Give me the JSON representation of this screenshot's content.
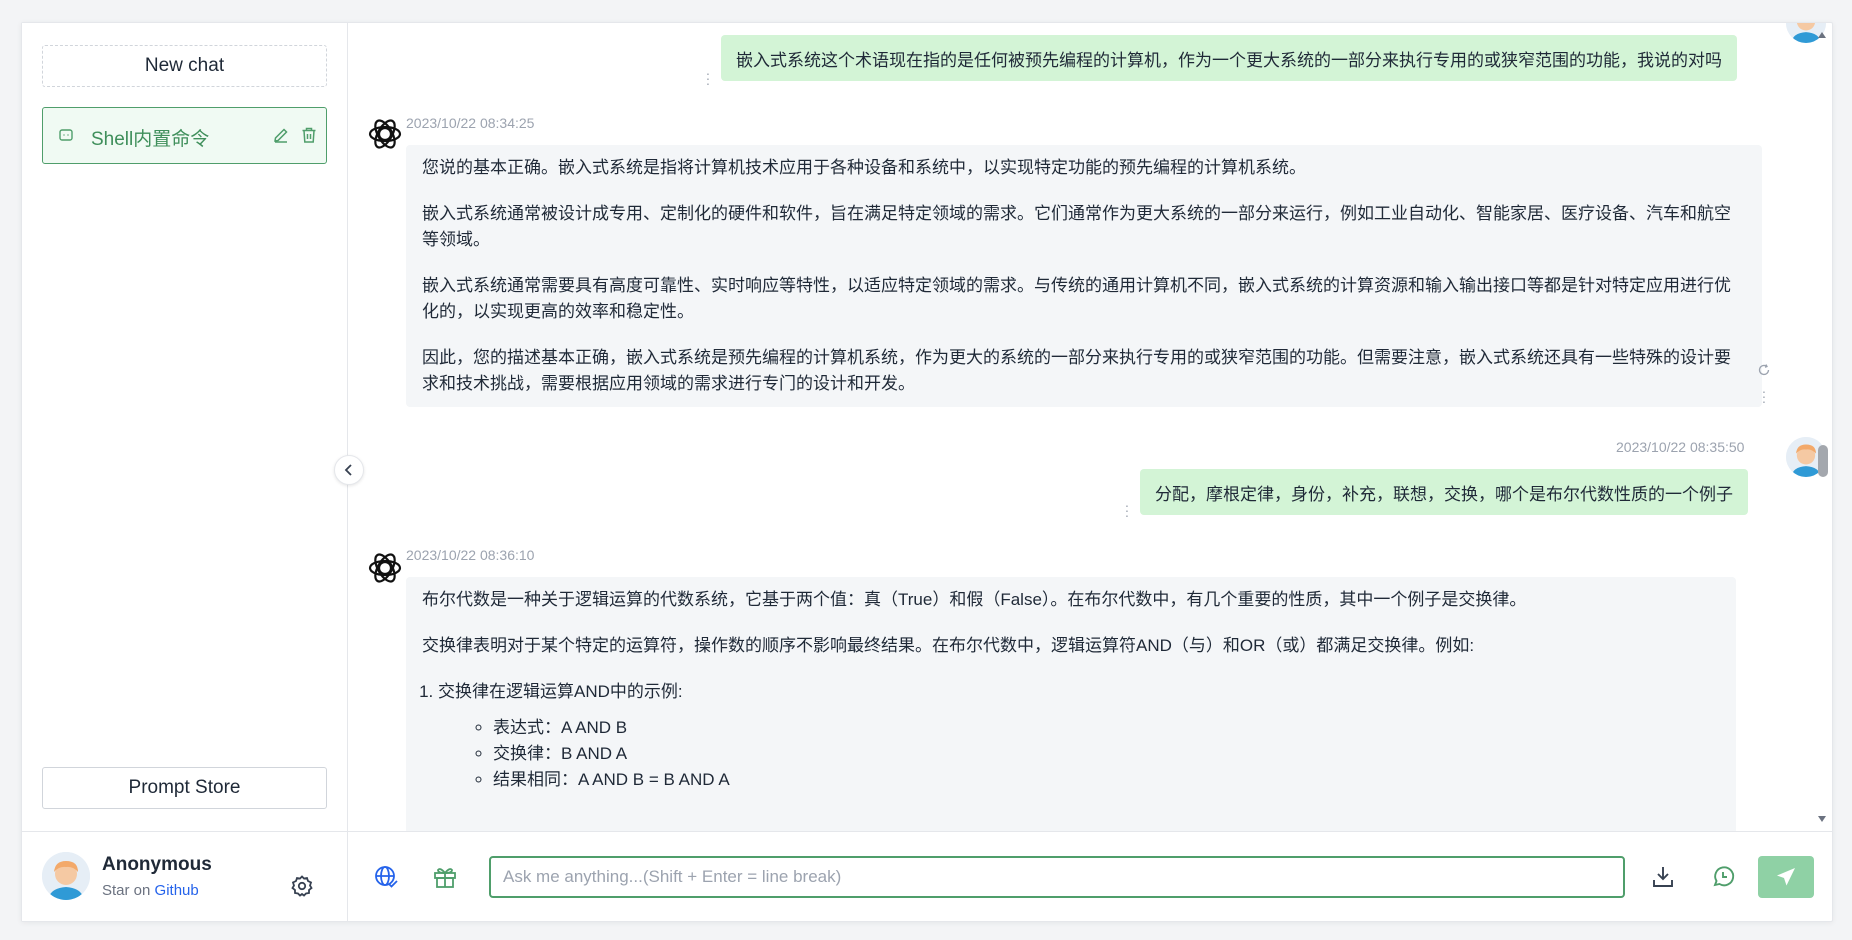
{
  "sidebar": {
    "new_chat_label": "New chat",
    "chats": [
      {
        "title": "Shell内置命令"
      }
    ],
    "prompt_store_label": "Prompt Store",
    "user": {
      "name": "Anonymous",
      "sub_prefix": "Star on ",
      "sub_link": "Github"
    }
  },
  "messages": [
    {
      "role": "user",
      "text": "嵌入式系统这个术语现在指的是任何被预先编程的计算机，作为一个更大系统的一部分来执行专用的或狭窄范围的功能，我说的对吗"
    },
    {
      "role": "assistant",
      "timestamp": "2023/10/22 08:34:25",
      "paragraphs": [
        "您说的基本正确。嵌入式系统是指将计算机技术应用于各种设备和系统中，以实现特定功能的预先编程的计算机系统。",
        "嵌入式系统通常被设计成专用、定制化的硬件和软件，旨在满足特定领域的需求。它们通常作为更大系统的一部分来运行，例如工业自动化、智能家居、医疗设备、汽车和航空等领域。",
        "嵌入式系统通常需要具有高度可靠性、实时响应等特性，以适应特定领域的需求。与传统的通用计算机不同，嵌入式系统的计算资源和输入输出接口等都是针对特定应用进行优化的，以实现更高的效率和稳定性。",
        "因此，您的描述基本正确，嵌入式系统是预先编程的计算机系统，作为更大的系统的一部分来执行专用的或狭窄范围的功能。但需要注意，嵌入式系统还具有一些特殊的设计要求和技术挑战，需要根据应用领域的需求进行专门的设计和开发。"
      ]
    },
    {
      "role": "user",
      "timestamp": "2023/10/22 08:35:50",
      "text": "分配，摩根定律，身份，补充，联想，交换，哪个是布尔代数性质的一个例子"
    },
    {
      "role": "assistant",
      "timestamp": "2023/10/22 08:36:10",
      "paragraphs": [
        "布尔代数是一种关于逻辑运算的代数系统，它基于两个值：真（True）和假（False）。在布尔代数中，有几个重要的性质，其中一个例子是交换律。",
        "交换律表明对于某个特定的运算符，操作数的顺序不影响最终结果。在布尔代数中，逻辑运算符AND（与）和OR（或）都满足交换律。例如:"
      ],
      "list_item": "交换律在逻辑运算AND中的示例:",
      "bullets": [
        "表达式：A AND B",
        "交换律：B AND A",
        "结果相同：A AND B = B AND A"
      ]
    }
  ],
  "input": {
    "placeholder": "Ask me anything...(Shift + Enter = line break)",
    "value": ""
  },
  "icons": {
    "settings": "gear-icon",
    "collapse": "chevron-left-icon",
    "web": "globe-icon",
    "prompt": "gift-icon",
    "download": "download-icon",
    "whatsapp": "chat-bubble-icon",
    "send": "send-icon"
  },
  "colors": {
    "accent": "#4f9e6b",
    "user_bubble": "#d3f4d6",
    "bot_bubble": "#f4f6f8",
    "send_button": "#8fd1a5",
    "link": "#2563eb"
  }
}
